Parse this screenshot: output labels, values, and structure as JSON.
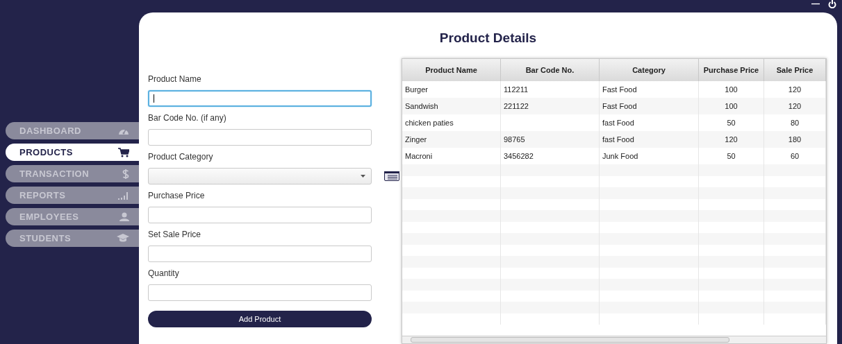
{
  "window": {
    "controls": [
      "—"
    ]
  },
  "sidebar": {
    "items": [
      {
        "label": "DASHBOARD",
        "kind": "gauge",
        "selected": false
      },
      {
        "label": "PRODUCTS",
        "kind": "cart",
        "selected": true
      },
      {
        "label": "TRANSACTION",
        "kind": "dollar",
        "selected": false
      },
      {
        "label": "REPORTS",
        "kind": "bars",
        "selected": false
      },
      {
        "label": "EMPLOYEES",
        "kind": "person",
        "selected": false
      },
      {
        "label": "STUDENTS",
        "kind": "cap",
        "selected": false
      }
    ]
  },
  "title": "Product Details",
  "form": {
    "fields": [
      {
        "label": "Product Name",
        "kind": "text",
        "focused": true
      },
      {
        "label": "Bar Code No. (if any)",
        "kind": "text",
        "focused": false
      },
      {
        "label": "Product Category",
        "kind": "combo",
        "focused": false
      },
      {
        "label": "Purchase Price",
        "kind": "text",
        "focused": false
      },
      {
        "label": "Set Sale Price",
        "kind": "text",
        "focused": false
      },
      {
        "label": "Quantity",
        "kind": "text",
        "focused": false
      }
    ],
    "button": "Add Product"
  },
  "table": {
    "columns": [
      "Product Name",
      "Bar Code No.",
      "Category",
      "Purchase Price",
      "Sale Price"
    ],
    "rows": [
      [
        "Burger",
        "112211",
        "Fast Food",
        "100",
        "120"
      ],
      [
        "Sandwish",
        "221122",
        "Fast Food",
        "100",
        "120"
      ],
      [
        "chicken paties",
        "",
        "fast Food",
        "50",
        "80"
      ],
      [
        "Zinger",
        "98765",
        "fast Food",
        "120",
        "180"
      ],
      [
        "Macroni",
        "3456282",
        "Junk Food",
        "50",
        "60"
      ]
    ]
  }
}
